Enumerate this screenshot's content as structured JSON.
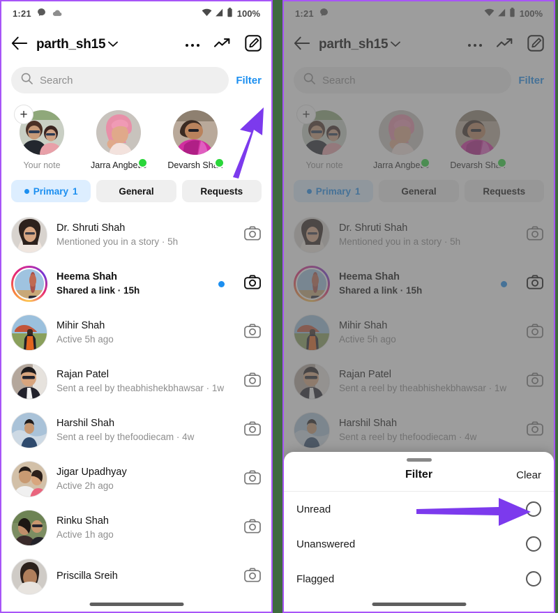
{
  "accent": {
    "purple_arrow": "#7C3AED",
    "instagram_blue": "#1C8FF0",
    "online_green": "#2AD63A",
    "divider_green": "#3F6B3F",
    "frame_purple": "#A855F7"
  },
  "status_bar": {
    "time": "1:21",
    "battery_percent": "100%",
    "icons_left": [
      "messenger-bubble-icon",
      "cloud-icon"
    ],
    "icons_right": [
      "wifi-icon",
      "cellular-signal-icon",
      "battery-icon"
    ]
  },
  "status_bar_right_phone": {
    "time": "1:21",
    "battery_percent": "100%",
    "icons_left": [
      "messenger-bubble-icon"
    ],
    "icons_right": [
      "wifi-icon",
      "cellular-signal-icon",
      "battery-icon"
    ]
  },
  "header": {
    "back_icon": "arrow-left-icon",
    "title": "parth_sh15",
    "chevron_icon": "chevron-down-icon",
    "more_icon": "more-horizontal-icon",
    "activity_icon": "trending-up-icon",
    "compose_icon": "compose-icon"
  },
  "search": {
    "icon": "search-icon",
    "placeholder": "Search",
    "value": "",
    "filter_label": "Filter"
  },
  "notes": [
    {
      "label": "Your note",
      "muted": true,
      "has_plus": true,
      "online": false,
      "avatar": "couple-selfie"
    },
    {
      "label": "Jarra Angbetic",
      "muted": false,
      "has_plus": false,
      "online": true,
      "avatar": "pink-hair-portrait"
    },
    {
      "label": "Devarsh Shah",
      "muted": false,
      "has_plus": false,
      "online": true,
      "avatar": "man-magenta-shirt"
    }
  ],
  "tabs": [
    {
      "label": "Primary",
      "count": "1",
      "active": true,
      "has_dot": true
    },
    {
      "label": "General",
      "count": "",
      "active": false,
      "has_dot": false
    },
    {
      "label": "Requests",
      "count": "",
      "active": false,
      "has_dot": false
    }
  ],
  "chats": [
    {
      "name": "Dr. Shruti Shah",
      "preview": "Mentioned you in a story · 5h",
      "unread": false,
      "blue_dot": false,
      "story_ring": false,
      "camera_icon": "camera-icon",
      "avatar": "woman-dark-hair"
    },
    {
      "name": "Heema Shah",
      "preview": "Shared a link · 15h",
      "unread": true,
      "blue_dot": true,
      "story_ring": true,
      "camera_icon": "camera-icon",
      "avatar": "monument-photo"
    },
    {
      "name": "Mihir Shah",
      "preview": "Active 5h ago",
      "unread": false,
      "blue_dot": false,
      "story_ring": false,
      "camera_icon": "camera-icon",
      "avatar": "man-orange-vest"
    },
    {
      "name": "Rajan Patel",
      "preview": "Sent a reel by theabhishekbhawsar · 1w",
      "unread": false,
      "blue_dot": false,
      "story_ring": false,
      "camera_icon": "camera-icon",
      "avatar": "man-sunglasses-suit"
    },
    {
      "name": "Harshil Shah",
      "preview": "Sent a reel by thefoodiecam · 4w",
      "unread": false,
      "blue_dot": false,
      "story_ring": false,
      "camera_icon": "camera-icon",
      "avatar": "man-snow-mountain"
    },
    {
      "name": "Jigar Upadhyay",
      "preview": "Active 2h ago",
      "unread": false,
      "blue_dot": false,
      "story_ring": false,
      "camera_icon": "camera-icon",
      "avatar": "couple-portrait"
    },
    {
      "name": "Rinku Shah",
      "preview": "Active 1h ago",
      "unread": false,
      "blue_dot": false,
      "story_ring": false,
      "camera_icon": "camera-icon",
      "avatar": "couple-outdoors"
    },
    {
      "name": "Priscilla Sreih",
      "preview": "",
      "unread": false,
      "blue_dot": false,
      "story_ring": false,
      "camera_icon": "camera-icon",
      "avatar": "woman-portrait"
    }
  ],
  "filter_sheet": {
    "title": "Filter",
    "clear_label": "Clear",
    "options": [
      {
        "label": "Unread",
        "selected": false
      },
      {
        "label": "Unanswered",
        "selected": false
      },
      {
        "label": "Flagged",
        "selected": false
      }
    ]
  },
  "annotations": [
    {
      "name": "arrow-to-filter-link",
      "direction": "up-right"
    },
    {
      "name": "arrow-to-unread-toggle",
      "direction": "right"
    }
  ]
}
